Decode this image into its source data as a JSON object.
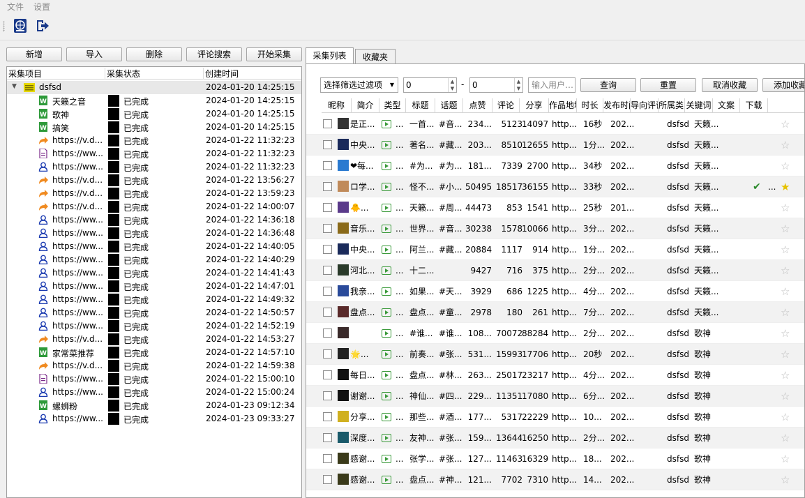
{
  "menu": {
    "file": "文件",
    "settings": "设置"
  },
  "actions": {
    "add": "新增",
    "import": "导入",
    "delete": "删除",
    "comment_search": "评论搜索",
    "start": "开始采集"
  },
  "tree": {
    "columns": [
      "采集项目",
      "采集状态",
      "创建时间"
    ],
    "root": {
      "name": "dsfsd",
      "time": "2024-01-20 14:25:15"
    },
    "items": [
      {
        "icon": "word",
        "name": "天籁之音",
        "status": "已完成",
        "time": "2024-01-20 14:25:15"
      },
      {
        "icon": "word",
        "name": "歌神",
        "status": "已完成",
        "time": "2024-01-20 14:25:15"
      },
      {
        "icon": "word",
        "name": "搞笑",
        "status": "已完成",
        "time": "2024-01-20 14:25:15"
      },
      {
        "icon": "share",
        "name": "https://v.d...",
        "status": "已完成",
        "time": "2024-01-22 11:32:23"
      },
      {
        "icon": "doc",
        "name": "https://ww...",
        "status": "已完成",
        "time": "2024-01-22 11:32:23"
      },
      {
        "icon": "user",
        "name": "https://ww...",
        "status": "已完成",
        "time": "2024-01-22 11:32:23"
      },
      {
        "icon": "share",
        "name": "https://v.d...",
        "status": "已完成",
        "time": "2024-01-22 13:56:27"
      },
      {
        "icon": "share",
        "name": "https://v.d...",
        "status": "已完成",
        "time": "2024-01-22 13:59:23"
      },
      {
        "icon": "share",
        "name": "https://v.d...",
        "status": "已完成",
        "time": "2024-01-22 14:00:07"
      },
      {
        "icon": "user",
        "name": "https://ww...",
        "status": "已完成",
        "time": "2024-01-22 14:36:18"
      },
      {
        "icon": "user",
        "name": "https://ww...",
        "status": "已完成",
        "time": "2024-01-22 14:36:48"
      },
      {
        "icon": "user",
        "name": "https://ww...",
        "status": "已完成",
        "time": "2024-01-22 14:40:05"
      },
      {
        "icon": "user",
        "name": "https://ww...",
        "status": "已完成",
        "time": "2024-01-22 14:40:29"
      },
      {
        "icon": "user",
        "name": "https://ww...",
        "status": "已完成",
        "time": "2024-01-22 14:41:43"
      },
      {
        "icon": "user",
        "name": "https://ww...",
        "status": "已完成",
        "time": "2024-01-22 14:47:01"
      },
      {
        "icon": "user",
        "name": "https://ww...",
        "status": "已完成",
        "time": "2024-01-22 14:49:32"
      },
      {
        "icon": "user",
        "name": "https://ww...",
        "status": "已完成",
        "time": "2024-01-22 14:50:57"
      },
      {
        "icon": "user",
        "name": "https://ww...",
        "status": "已完成",
        "time": "2024-01-22 14:52:19"
      },
      {
        "icon": "share",
        "name": "https://v.d...",
        "status": "已完成",
        "time": "2024-01-22 14:53:27"
      },
      {
        "icon": "word",
        "name": "家常菜推荐",
        "status": "已完成",
        "time": "2024-01-22 14:57:10"
      },
      {
        "icon": "share",
        "name": "https://v.d...",
        "status": "已完成",
        "time": "2024-01-22 14:59:38"
      },
      {
        "icon": "doc",
        "name": "https://ww...",
        "status": "已完成",
        "time": "2024-01-22 15:00:10"
      },
      {
        "icon": "user",
        "name": "https://ww...",
        "status": "已完成",
        "time": "2024-01-22 15:00:24"
      },
      {
        "icon": "word",
        "name": "螺蛳粉",
        "status": "已完成",
        "time": "2024-01-23 09:12:34"
      },
      {
        "icon": "user",
        "name": "https://ww...",
        "status": "已完成",
        "time": "2024-01-23 09:33:27"
      }
    ]
  },
  "tabs": [
    "采集列表",
    "收藏夹"
  ],
  "filter": {
    "select": "选择筛选过滤项",
    "from": "0",
    "dash": "-",
    "to": "0",
    "user_placeholder": "输入用户…",
    "query": "查询",
    "reset": "重置",
    "unfav": "取消收藏",
    "addfav": "添加收藏"
  },
  "grid": {
    "columns": [
      "昵称",
      "简介",
      "类型",
      "标题",
      "话题",
      "点赞",
      "评论",
      "分享",
      "作品地址",
      "时长",
      "发布时间",
      "导向评论",
      "所属类目",
      "关键词",
      "文案",
      "下载"
    ],
    "rows": [
      {
        "av": "#333",
        "nick": "是正...",
        "intro": "...",
        "title": "一首...",
        "topic": "#音...",
        "like": "234...",
        "cmt": "5123",
        "share": "14097",
        "url": "http...",
        "dur": "16秒",
        "pub": "202...",
        "cat": "dsfsd",
        "kw": "天籁...",
        "fav": false
      },
      {
        "av": "#1a2a5a",
        "nick": "中央...",
        "intro": "...",
        "title": "著名...",
        "topic": "#藏...",
        "like": "203...",
        "cmt": "8510",
        "share": "12655",
        "url": "http...",
        "dur": "1分...",
        "pub": "202...",
        "cat": "dsfsd",
        "kw": "天籁...",
        "fav": false
      },
      {
        "av": "#2a7ad0",
        "nick": "❤每...",
        "intro": "...",
        "title": "#为...",
        "topic": "#为...",
        "like": "181...",
        "cmt": "7339",
        "share": "2700",
        "url": "http...",
        "dur": "34秒",
        "pub": "202...",
        "cat": "dsfsd",
        "kw": "天籁...",
        "fav": false
      },
      {
        "av": "#c08a5a",
        "nick": "ロ学...",
        "intro": "...",
        "title": "怪不...",
        "topic": "#小...",
        "like": "50495",
        "cmt": "18517",
        "share": "36155",
        "url": "http...",
        "dur": "33秒",
        "pub": "202...",
        "cat": "dsfsd",
        "kw": "天籁...",
        "fav": true,
        "done": true
      },
      {
        "av": "#5a3a8a",
        "nick": "🐥...",
        "intro": "...",
        "title": "天籁...",
        "topic": "#周...",
        "like": "44473",
        "cmt": "853",
        "share": "1541",
        "url": "http...",
        "dur": "25秒",
        "pub": "201...",
        "cat": "dsfsd",
        "kw": "天籁...",
        "fav": false
      },
      {
        "av": "#8a6a1a",
        "nick": "音乐...",
        "intro": "...",
        "title": "世界...",
        "topic": "#音...",
        "like": "30238",
        "cmt": "1578",
        "share": "10066",
        "url": "http...",
        "dur": "3分...",
        "pub": "202...",
        "cat": "dsfsd",
        "kw": "天籁...",
        "fav": false
      },
      {
        "av": "#1a2a5a",
        "nick": "中央...",
        "intro": "...",
        "title": "阿兰...",
        "topic": "#藏...",
        "like": "20884",
        "cmt": "1117",
        "share": "914",
        "url": "http...",
        "dur": "1分...",
        "pub": "202...",
        "cat": "dsfsd",
        "kw": "天籁...",
        "fav": false
      },
      {
        "av": "#2a3a2a",
        "nick": "河北...",
        "intro": "...",
        "title": "十二...",
        "topic": "",
        "like": "9427",
        "cmt": "716",
        "share": "375",
        "url": "http...",
        "dur": "2分...",
        "pub": "202...",
        "cat": "dsfsd",
        "kw": "天籁...",
        "fav": false
      },
      {
        "av": "#2a4a9a",
        "nick": "我亲...",
        "intro": "...",
        "title": "如果...",
        "topic": "#天...",
        "like": "3929",
        "cmt": "686",
        "share": "1225",
        "url": "http...",
        "dur": "4分...",
        "pub": "202...",
        "cat": "dsfsd",
        "kw": "天籁...",
        "fav": false
      },
      {
        "av": "#5a2a2a",
        "nick": "盘点...",
        "intro": "...",
        "title": "盘点...",
        "topic": "#童...",
        "like": "2978",
        "cmt": "180",
        "share": "261",
        "url": "http...",
        "dur": "7分...",
        "pub": "202...",
        "cat": "dsfsd",
        "kw": "天籁...",
        "fav": false
      },
      {
        "av": "#3a2a2a",
        "nick": "",
        "intro": "...",
        "title": "#谁...",
        "topic": "#谁...",
        "like": "108...",
        "cmt": "70072",
        "share": "88284",
        "url": "http...",
        "dur": "2分...",
        "pub": "202...",
        "cat": "dsfsd",
        "kw": "歌神",
        "fav": false
      },
      {
        "av": "#222",
        "nick": "🌟...",
        "intro": "...",
        "title": "前奏...",
        "topic": "#张...",
        "like": "531...",
        "cmt": "15993",
        "share": "17706",
        "url": "http...",
        "dur": "20秒",
        "pub": "202...",
        "cat": "dsfsd",
        "kw": "歌神",
        "fav": false
      },
      {
        "av": "#111",
        "nick": "每日...",
        "intro": "...",
        "title": "盘点...",
        "topic": "#林...",
        "like": "263...",
        "cmt": "25017",
        "share": "23217",
        "url": "http...",
        "dur": "4分...",
        "pub": "202...",
        "cat": "dsfsd",
        "kw": "歌神",
        "fav": false
      },
      {
        "av": "#111",
        "nick": "谢谢...",
        "intro": "...",
        "title": "神仙...",
        "topic": "#四...",
        "like": "229...",
        "cmt": "11351",
        "share": "17080",
        "url": "http...",
        "dur": "6分...",
        "pub": "202...",
        "cat": "dsfsd",
        "kw": "歌神",
        "fav": false
      },
      {
        "av": "#d0b020",
        "nick": "分享...",
        "intro": "...",
        "title": "那些...",
        "topic": "#酒...",
        "like": "177...",
        "cmt": "5317",
        "share": "22229",
        "url": "http...",
        "dur": "10...",
        "pub": "202...",
        "cat": "dsfsd",
        "kw": "歌神",
        "fav": false
      },
      {
        "av": "#1a5a6a",
        "nick": "深度...",
        "intro": "...",
        "title": "友神...",
        "topic": "#张...",
        "like": "159...",
        "cmt": "13644",
        "share": "16250",
        "url": "http...",
        "dur": "2分...",
        "pub": "202...",
        "cat": "dsfsd",
        "kw": "歌神",
        "fav": false
      },
      {
        "av": "#3a3a1a",
        "nick": "感谢...",
        "intro": "...",
        "title": "张学...",
        "topic": "#张...",
        "like": "127...",
        "cmt": "11463",
        "share": "16329",
        "url": "http...",
        "dur": "18...",
        "pub": "202...",
        "cat": "dsfsd",
        "kw": "歌神",
        "fav": false
      },
      {
        "av": "#3a3a1a",
        "nick": "感谢...",
        "intro": "...",
        "title": "盘点...",
        "topic": "#神...",
        "like": "121...",
        "cmt": "7702",
        "share": "7310",
        "url": "http...",
        "dur": "14...",
        "pub": "202...",
        "cat": "dsfsd",
        "kw": "歌神",
        "fav": false
      }
    ]
  }
}
